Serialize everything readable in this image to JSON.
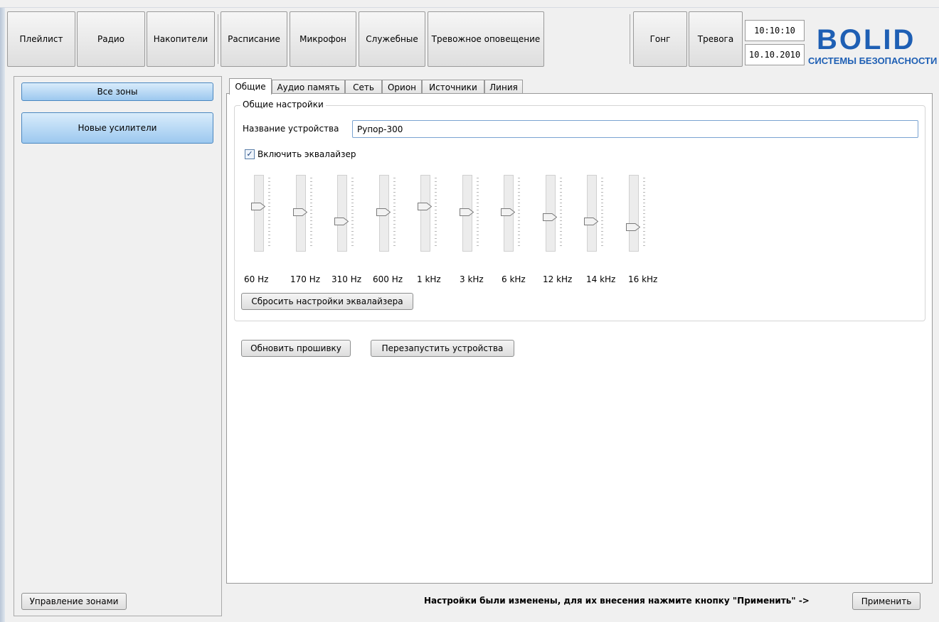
{
  "toolbar": {
    "buttons": [
      "Плейлист",
      "Радио",
      "Накопители",
      "Расписание",
      "Микрофон",
      "Служебные",
      "Тревожное оповещение",
      "Гонг",
      "Тревога"
    ],
    "time": "10:10:10",
    "date": "10.10.2010"
  },
  "logo": {
    "word": "BOLID",
    "subtitle": "СИСТЕМЫ БЕЗОПАСНОСТИ",
    "color": "#1e5fb4"
  },
  "sidebar": {
    "all_zones": "Все зоны",
    "new_amplifiers": "Новые усилители",
    "manage_zones": "Управление зонами"
  },
  "tabs": [
    "Общие",
    "Аудио память",
    "Сеть",
    "Орион",
    "Источники",
    "Линия"
  ],
  "general": {
    "group_title": "Общие настройки",
    "device_name_label": "Название устройства",
    "device_name_value": "Рупор-300",
    "equalizer_checkbox": "Включить эквалайзер",
    "equalizer_enabled": true,
    "reset_button": "Сбросить настройки эквалайзера"
  },
  "equalizer": {
    "bands": [
      {
        "label": "60 Hz",
        "level": 0.6
      },
      {
        "label": "170 Hz",
        "level": 0.52
      },
      {
        "label": "310 Hz",
        "level": 0.38
      },
      {
        "label": "600 Hz",
        "level": 0.52
      },
      {
        "label": "1 kHz",
        "level": 0.6
      },
      {
        "label": "3 kHz",
        "level": 0.52
      },
      {
        "label": "6 kHz",
        "level": 0.52
      },
      {
        "label": "12 kHz",
        "level": 0.44
      },
      {
        "label": "14 kHz",
        "level": 0.38
      },
      {
        "label": "16 kHz",
        "level": 0.3
      }
    ]
  },
  "actions": {
    "update_firmware": "Обновить прошивку",
    "restart_devices": "Перезапустить устройства"
  },
  "status": {
    "message": "Настройки были изменены, для их внесения нажмите кнопку \"Применить\" ->",
    "apply_button": "Применить"
  }
}
